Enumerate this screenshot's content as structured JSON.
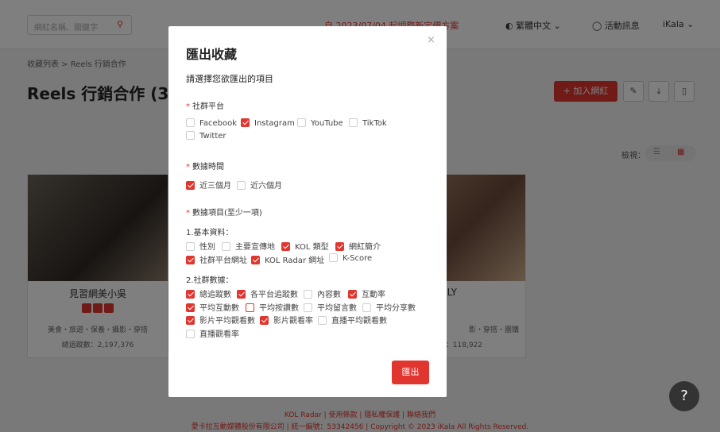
{
  "header": {
    "search_placeholder": "網紅名稱、關鍵字",
    "notice": "自 2023/07/04 起調整新定價方案",
    "language": "繁體中文",
    "news": "活動訊息",
    "user": "iKala"
  },
  "breadcrumb": "收藏列表 > Reels 行銷合作",
  "page_title": "Reels 行銷合作 (3)",
  "toolbar": {
    "add_label": "加入網紅"
  },
  "view": {
    "label": "檢視："
  },
  "cards": [
    {
      "name": "見習網美小吳",
      "tags": "美食・旅遊・保養・攝影・穿搭",
      "fans": "總追蹤數：2,197,376"
    },
    {
      "name": "LY",
      "tags": "影・穿搭・團購",
      "fans": "：118,922"
    }
  ],
  "footer": {
    "links": "KOL Radar | 使用條款 | 隱私權保護 | 聯絡我們",
    "copyright": "愛卡拉互動媒體股份有限公司 | 統一編號：53342456 | Copyright © 2023 iKala All Rights Reserved."
  },
  "modal": {
    "title": "匯出收藏",
    "subtitle": "請選擇您欲匯出的項目",
    "section_platform": "社群平台",
    "platforms": [
      {
        "label": "Facebook",
        "checked": false
      },
      {
        "label": "Instagram",
        "checked": true
      },
      {
        "label": "YouTube",
        "checked": false
      },
      {
        "label": "TikTok",
        "checked": false
      },
      {
        "label": "Twitter",
        "checked": false
      }
    ],
    "section_time": "數據時間",
    "times": [
      {
        "label": "近三個月",
        "checked": true
      },
      {
        "label": "近六個月",
        "checked": false
      }
    ],
    "section_items": "數據項目(至少一項)",
    "group_basic": "1.基本資料：",
    "basic": [
      {
        "label": "性別",
        "checked": false
      },
      {
        "label": "主要宣傳地",
        "checked": false
      },
      {
        "label": "KOL 類型",
        "checked": true
      },
      {
        "label": "網紅簡介",
        "checked": true
      },
      {
        "label": "社群平台網址",
        "checked": true
      },
      {
        "label": "KOL Radar 網址",
        "checked": true
      },
      {
        "label": "K-Score",
        "checked": false
      }
    ],
    "group_social": "2.社群數據：",
    "social": [
      {
        "label": "總追蹤數",
        "checked": true
      },
      {
        "label": "各平台追蹤數",
        "checked": true
      },
      {
        "label": "內容數",
        "checked": false
      },
      {
        "label": "互動率",
        "checked": true
      },
      {
        "label": "平均互動數",
        "checked": true
      },
      {
        "label": "平均按讚數",
        "checked": false
      },
      {
        "label": "平均留言數",
        "checked": false
      },
      {
        "label": "平均分享數",
        "checked": false
      },
      {
        "label": "影片平均觀看數",
        "checked": true
      },
      {
        "label": "影片觀看率",
        "checked": true
      },
      {
        "label": "直播平均觀看數",
        "checked": false
      },
      {
        "label": "直播觀看率",
        "checked": false
      }
    ],
    "export_label": "匯出",
    "close_icon": "×"
  },
  "colors": {
    "accent": "#e0362f",
    "overlay": "rgba(0,0,0,0.5)"
  }
}
